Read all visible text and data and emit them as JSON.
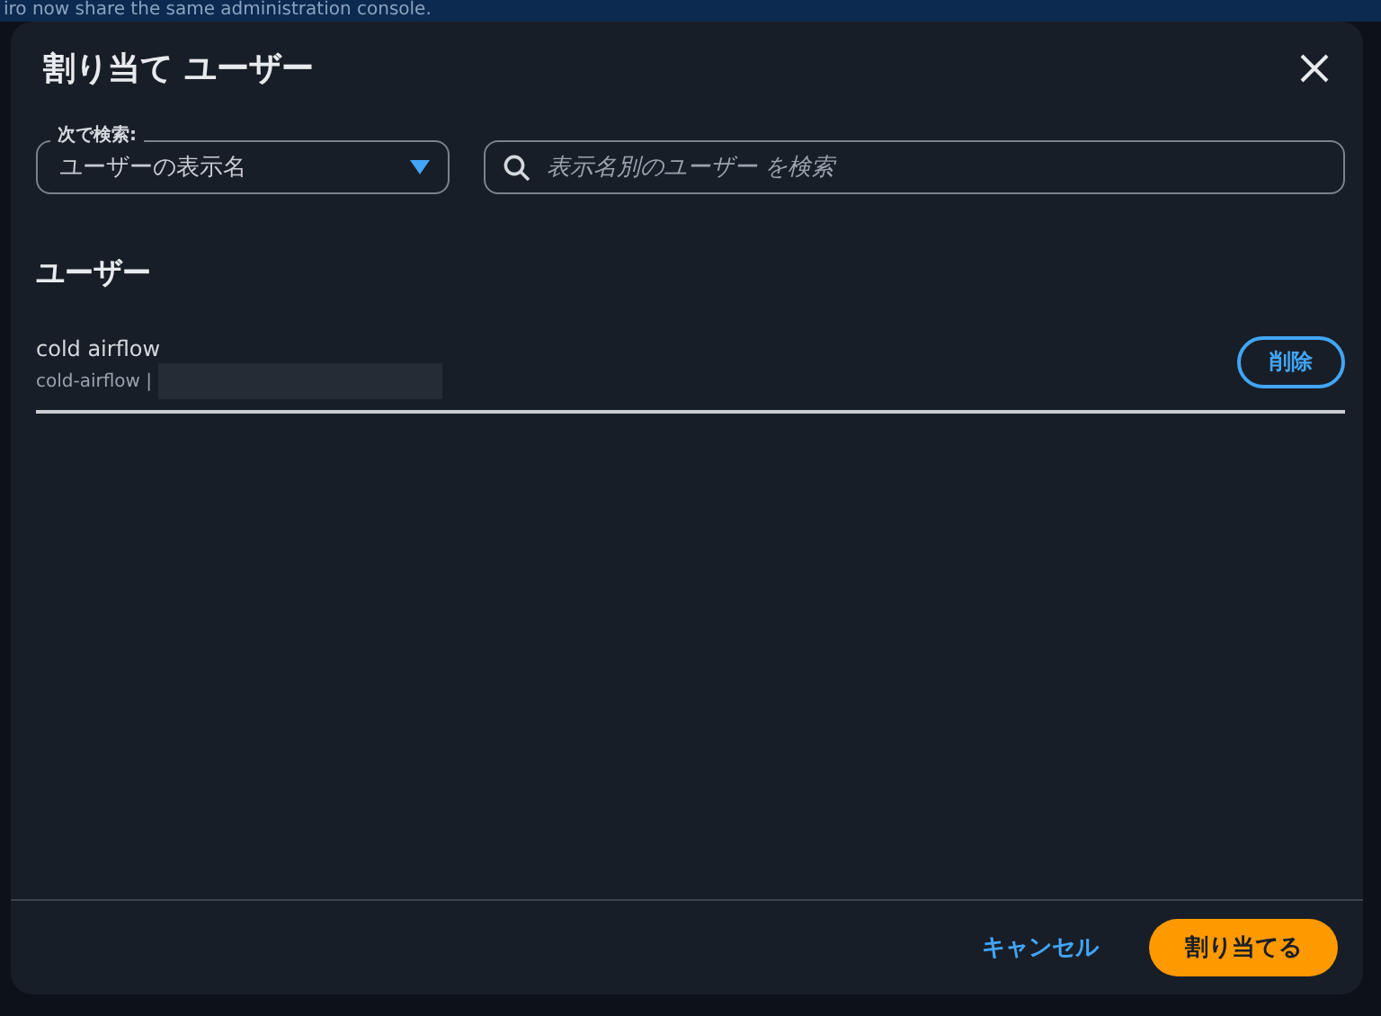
{
  "banner": {
    "text": "iro now share the same administration console."
  },
  "dialog": {
    "title": "割り当て ユーザー",
    "filter": {
      "label": "次で検索:",
      "value": "ユーザーの表示名"
    },
    "search": {
      "placeholder": "表示名別のユーザー を検索"
    },
    "section_title": "ユーザー",
    "users": [
      {
        "name": "cold airflow",
        "detail": "cold-airflow |",
        "redacted": true,
        "action": "削除"
      }
    ],
    "buttons": [
      {
        "label": "キャンセル",
        "kind": "link"
      },
      {
        "label": "割り当てる",
        "kind": "primary"
      }
    ]
  }
}
